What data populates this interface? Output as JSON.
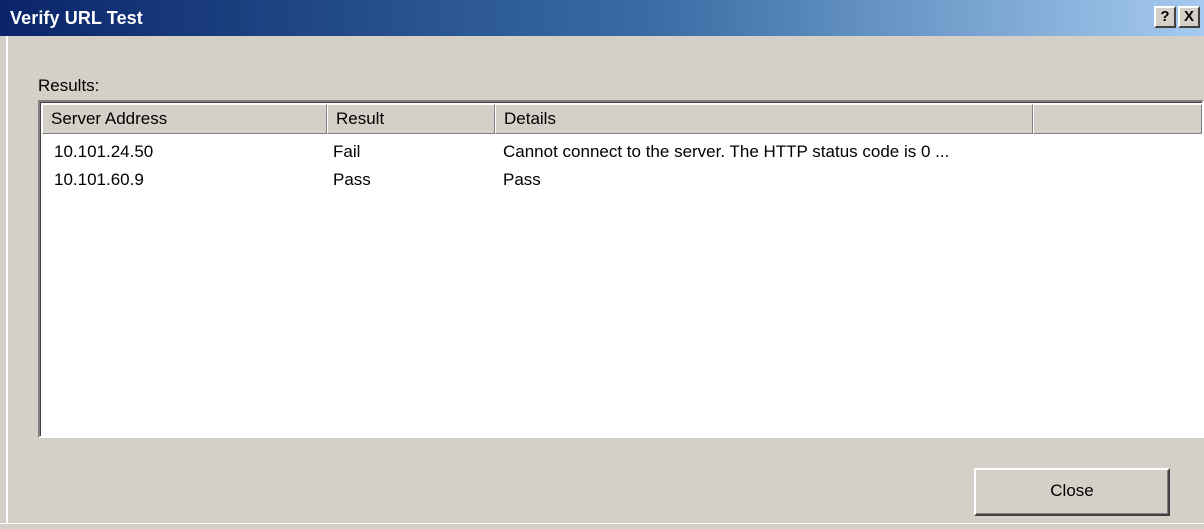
{
  "window": {
    "title": "Verify URL Test",
    "help_glyph": "?",
    "close_glyph": "X"
  },
  "results": {
    "label": "Results:",
    "columns": [
      "Server Address",
      "Result",
      "Details",
      ""
    ],
    "rows": [
      [
        "10.101.24.50",
        "Fail",
        "Cannot connect to the server. The HTTP status code is 0 ..."
      ],
      [
        "10.101.60.9",
        "Pass",
        "Pass"
      ]
    ]
  },
  "buttons": {
    "close_label": "Close"
  },
  "colors": {
    "titlebar_start": "#0a246a",
    "titlebar_end": "#a6caf0",
    "dialog_bg": "#d4d0c8"
  }
}
